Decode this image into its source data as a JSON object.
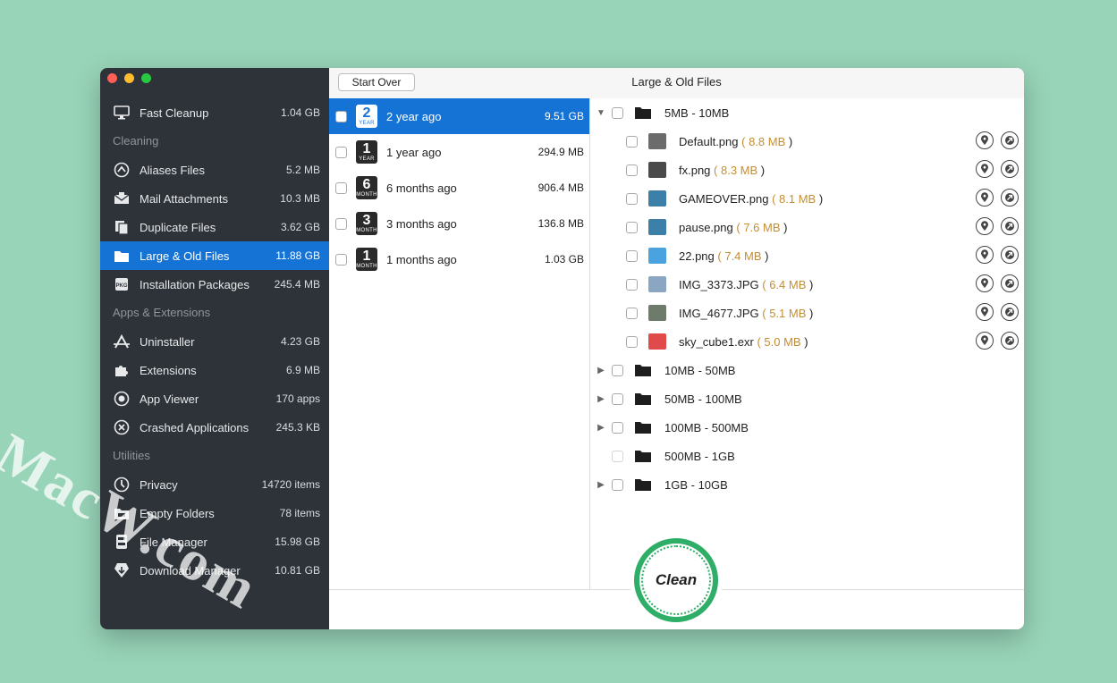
{
  "window": {
    "title": "Large & Old Files",
    "start_over": "Start Over",
    "traffic_colors": [
      "#fe5f57",
      "#febc2e",
      "#28c840"
    ]
  },
  "sidebar": {
    "fast_cleanup": {
      "label": "Fast Cleanup",
      "value": "1.04 GB",
      "icon": "monitor-icon"
    },
    "sections": [
      {
        "title": "Cleaning",
        "items": [
          {
            "label": "Aliases Files",
            "value": "5.2 MB",
            "icon": "alias-icon"
          },
          {
            "label": "Mail Attachments",
            "value": "10.3 MB",
            "icon": "mail-icon"
          },
          {
            "label": "Duplicate Files",
            "value": "3.62 GB",
            "icon": "duplicate-icon"
          },
          {
            "label": "Large & Old Files",
            "value": "11.88 GB",
            "icon": "folder-icon",
            "selected": true
          },
          {
            "label": "Installation Packages",
            "value": "245.4 MB",
            "icon": "package-icon"
          }
        ]
      },
      {
        "title": "Apps & Extensions",
        "items": [
          {
            "label": "Uninstaller",
            "value": "4.23 GB",
            "icon": "app-store-icon"
          },
          {
            "label": "Extensions",
            "value": "6.9 MB",
            "icon": "puzzle-icon"
          },
          {
            "label": "App Viewer",
            "value": "170 apps",
            "icon": "eye-icon"
          },
          {
            "label": "Crashed Applications",
            "value": "245.3 KB",
            "icon": "crash-icon"
          }
        ]
      },
      {
        "title": "Utilities",
        "items": [
          {
            "label": "Privacy",
            "value": "14720 items",
            "icon": "privacy-icon"
          },
          {
            "label": "Empty Folders",
            "value": "78 items",
            "icon": "empty-folder-icon"
          },
          {
            "label": "File Manager",
            "value": "15.98 GB",
            "icon": "file-manager-icon"
          },
          {
            "label": "Download Manager",
            "value": "10.81 GB",
            "icon": "download-icon"
          }
        ]
      }
    ]
  },
  "ages": [
    {
      "num": "2",
      "unit": "YEAR",
      "label": "2 year ago",
      "value": "9.51 GB",
      "selected": true
    },
    {
      "num": "1",
      "unit": "YEAR",
      "label": "1 year ago",
      "value": "294.9 MB"
    },
    {
      "num": "6",
      "unit": "MONTH",
      "label": "6 months ago",
      "value": "906.4 MB"
    },
    {
      "num": "3",
      "unit": "MONTH",
      "label": "3 months ago",
      "value": "136.8 MB"
    },
    {
      "num": "1",
      "unit": "MONTH",
      "label": "1 months ago",
      "value": "1.03 GB"
    }
  ],
  "tree": {
    "expanded_group": "5MB - 10MB",
    "files": [
      {
        "name": "Default.png",
        "size": "8.8 MB",
        "thumb": "#6b6b6b"
      },
      {
        "name": "fx.png",
        "size": "8.3 MB",
        "thumb": "#4a4a4a"
      },
      {
        "name": "GAMEOVER.png",
        "size": "8.1 MB",
        "thumb": "#3c7fa8"
      },
      {
        "name": "pause.png",
        "size": "7.6 MB",
        "thumb": "#3c7fa8"
      },
      {
        "name": "22.png",
        "size": "7.4 MB",
        "thumb": "#4aa3df"
      },
      {
        "name": "IMG_3373.JPG",
        "size": "6.4 MB",
        "thumb": "#8aa6c2"
      },
      {
        "name": "IMG_4677.JPG",
        "size": "5.1 MB",
        "thumb": "#6f7b6a"
      },
      {
        "name": "sky_cube1.exr",
        "size": "5.0 MB",
        "thumb": "#e04a4a"
      }
    ],
    "groups": [
      {
        "label": "10MB - 50MB",
        "arrow": true
      },
      {
        "label": "50MB - 100MB",
        "arrow": true
      },
      {
        "label": "100MB - 500MB",
        "arrow": true
      },
      {
        "label": "500MB - 1GB",
        "arrow": false
      },
      {
        "label": "1GB - 10GB",
        "arrow": true
      }
    ],
    "size_open": "( ",
    "size_close": " )"
  },
  "clean_label": "Clean",
  "watermark": "MacW.com",
  "colors": {
    "accent": "#1673d6",
    "clean_ring": "#2eae67",
    "size_text": "#c48d34"
  }
}
